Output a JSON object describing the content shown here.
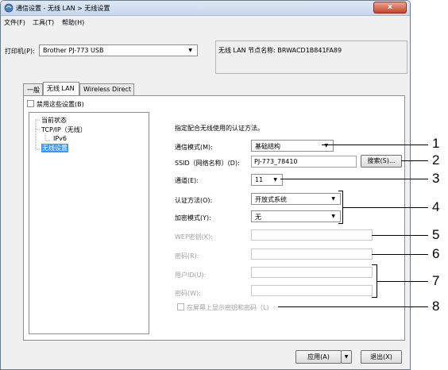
{
  "window": {
    "title": "通信设置 - 无线 LAN > 无线设置",
    "close_glyph": "x"
  },
  "menu": {
    "items": [
      "文件(F)",
      "工具(T)",
      "帮助(H)"
    ]
  },
  "printer": {
    "label": "打印机(P):",
    "selected": "Brother PJ-773 USB",
    "node_name_text": "无线 LAN 节点名称: BRWACD1B841FA89"
  },
  "tabs": [
    {
      "label": "一般",
      "active": false
    },
    {
      "label": "无线 LAN",
      "active": true
    },
    {
      "label": "Wireless Direct",
      "active": false
    }
  ],
  "disable_settings_label": "禁用这些设置(B)",
  "tree": {
    "items": [
      "当前状态",
      "TCP/IP（无线）",
      "IPv6",
      "无线设置"
    ]
  },
  "form": {
    "heading": "指定配合无线使用的认证方法。",
    "comm_mode_label": "通信模式(M):",
    "comm_mode_value": "基础结构",
    "ssid_label": "SSID（网络名称）(D):",
    "ssid_value": "PJ-773_78410",
    "search_button": "搜索(S)...",
    "channel_label": "通道(E):",
    "channel_value": "11",
    "auth_label": "认证方法(O):",
    "auth_value": "开放式系统",
    "encrypt_label": "加密模式(Y):",
    "encrypt_value": "无",
    "wep_label": "WEP密钥(K):",
    "password1_label": "密码(R):",
    "userid_label": "用户ID(U):",
    "password2_label": "密码(W):",
    "show_key_label": "在屏幕上显示密钥和密码（L)"
  },
  "footer": {
    "apply_button": "应用(A)",
    "exit_button": "退出(X)"
  },
  "callouts": [
    "1",
    "2",
    "3",
    "4",
    "5",
    "6",
    "7",
    "8"
  ],
  "colors": {
    "selection": "#3399ff",
    "close_button": "#c7452d"
  }
}
